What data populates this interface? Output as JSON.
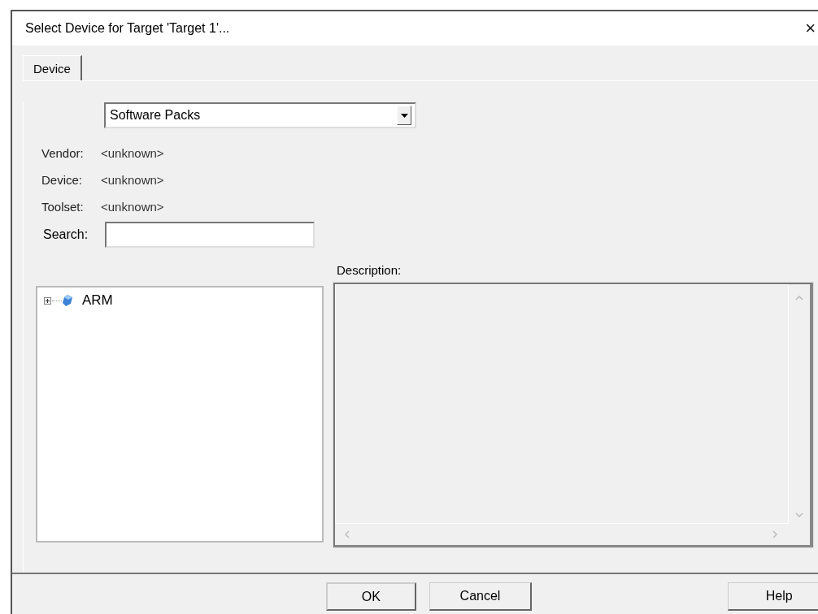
{
  "window": {
    "title": "Select Device for Target 'Target 1'...",
    "close": "×"
  },
  "tabs": [
    {
      "label": "Device",
      "selected": true
    }
  ],
  "source_dropdown": {
    "value": "Software Packs"
  },
  "info": [
    {
      "label": "Vendor:",
      "value": "<unknown>"
    },
    {
      "label": "Device:",
      "value": "<unknown>"
    },
    {
      "label": "Toolset:",
      "value": "<unknown>"
    }
  ],
  "search": {
    "label": "Search:"
  },
  "tree": [
    {
      "label": "ARM",
      "expanded": false
    }
  ],
  "description": {
    "label": "Description:"
  },
  "buttons": [
    {
      "label": "OK",
      "kind": "default"
    },
    {
      "label": "Cancel",
      "kind": "normal"
    },
    {
      "label": "Help",
      "kind": "help"
    }
  ]
}
